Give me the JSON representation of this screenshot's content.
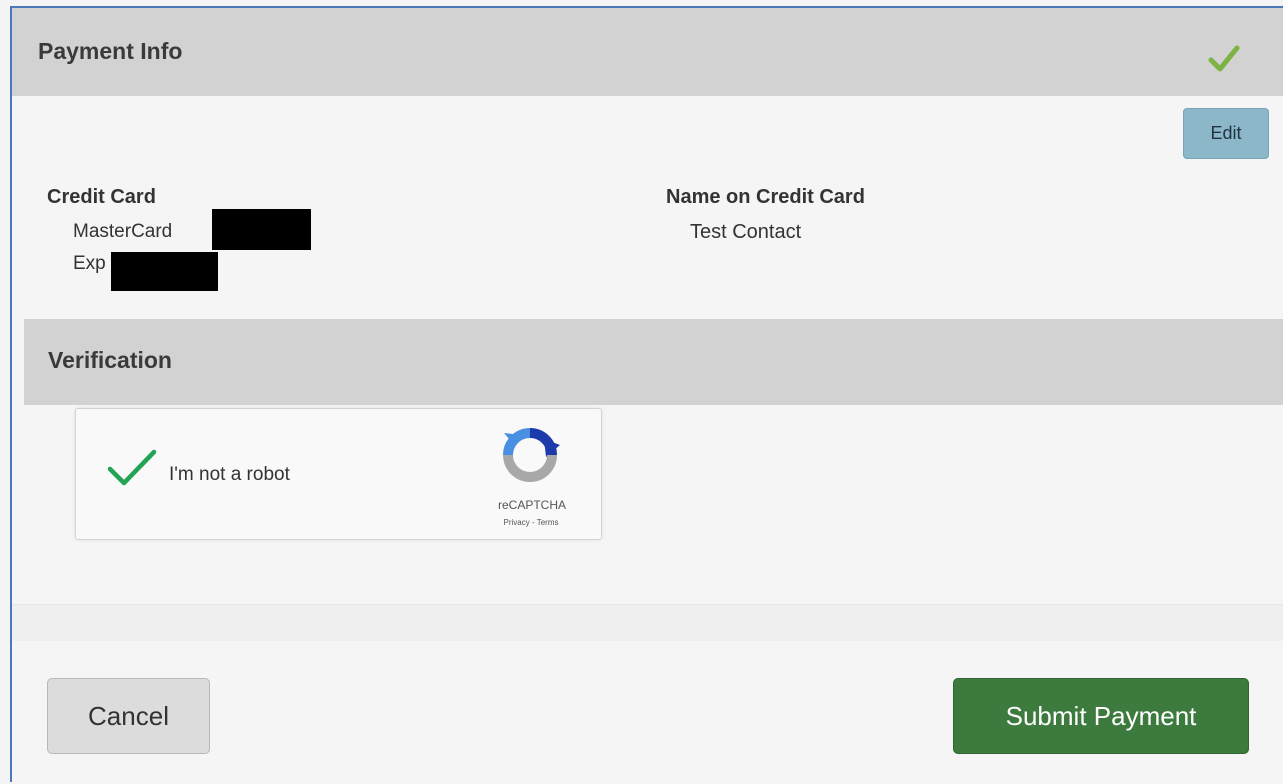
{
  "payment_panel": {
    "title": "Payment Info",
    "status_icon": "check-icon",
    "status_color": "#7cb342",
    "edit_label": "Edit",
    "credit_card": {
      "label": "Credit Card",
      "type": "MasterCard",
      "exp_prefix": "Exp"
    },
    "name_on_card": {
      "label": "Name on Credit Card",
      "value": "Test Contact"
    }
  },
  "verification": {
    "title": "Verification",
    "recaptcha": {
      "label": "I'm not a robot",
      "brand": "reCAPTCHA",
      "links": "Privacy - Terms",
      "checked": true,
      "check_color": "#23a455"
    }
  },
  "footer": {
    "cancel_label": "Cancel",
    "submit_label": "Submit Payment",
    "submit_color": "#3d7a3d"
  }
}
